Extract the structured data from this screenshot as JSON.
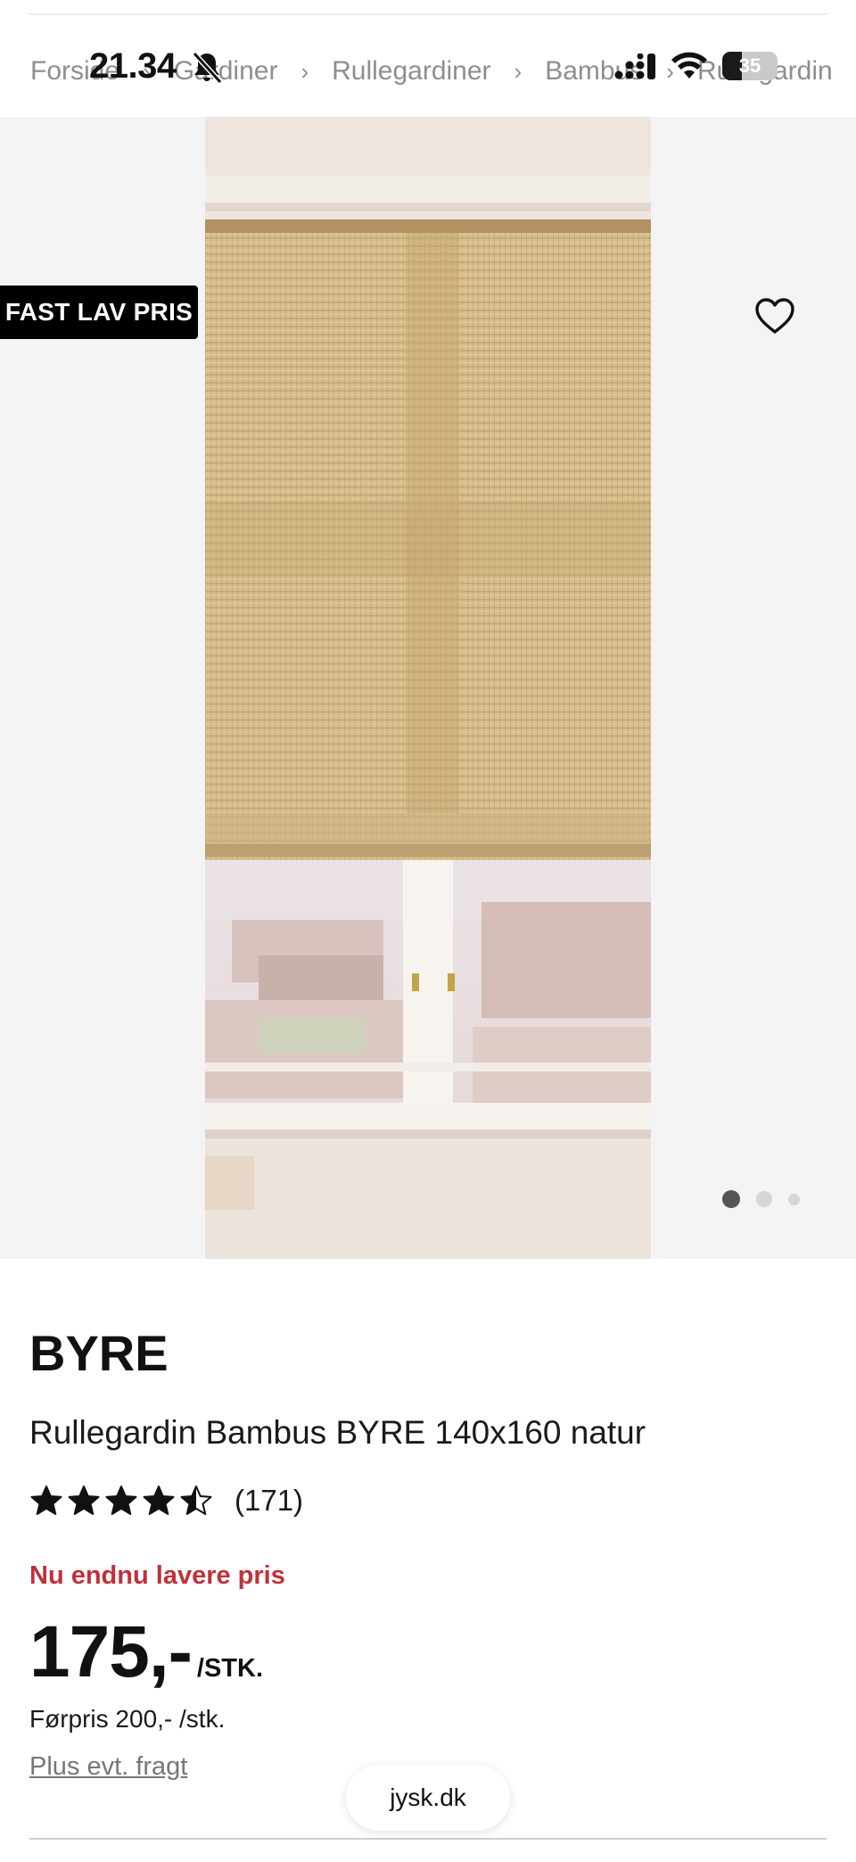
{
  "status_bar": {
    "time": "21.34",
    "battery": "35",
    "battery_level": 0.35
  },
  "breadcrumb": [
    "Forside",
    "Gardiner",
    "Rullegardiner",
    "Bambus",
    "Rullegardin"
  ],
  "gallery": {
    "badge": "FAST LAV PRIS",
    "favorite_icon": "heart-outline-icon",
    "image_count": 3,
    "active_image": 1
  },
  "product": {
    "brand": "BYRE",
    "title": "Rullegardin Bambus BYRE 140x160 natur",
    "rating": 4.5,
    "review_count": "(171)",
    "promo_text": "Nu endnu lavere pris",
    "price": "175,-",
    "unit": "/STK.",
    "before_price": "Førpris 200,- /stk.",
    "freight_link": "Plus evt. fragt"
  },
  "browser": {
    "url": "jysk.dk"
  },
  "colors": {
    "promo": "#c0313a",
    "badge_bg": "#000000",
    "text": "#1a1a1a",
    "gallery_bg": "#f4f4f4"
  }
}
